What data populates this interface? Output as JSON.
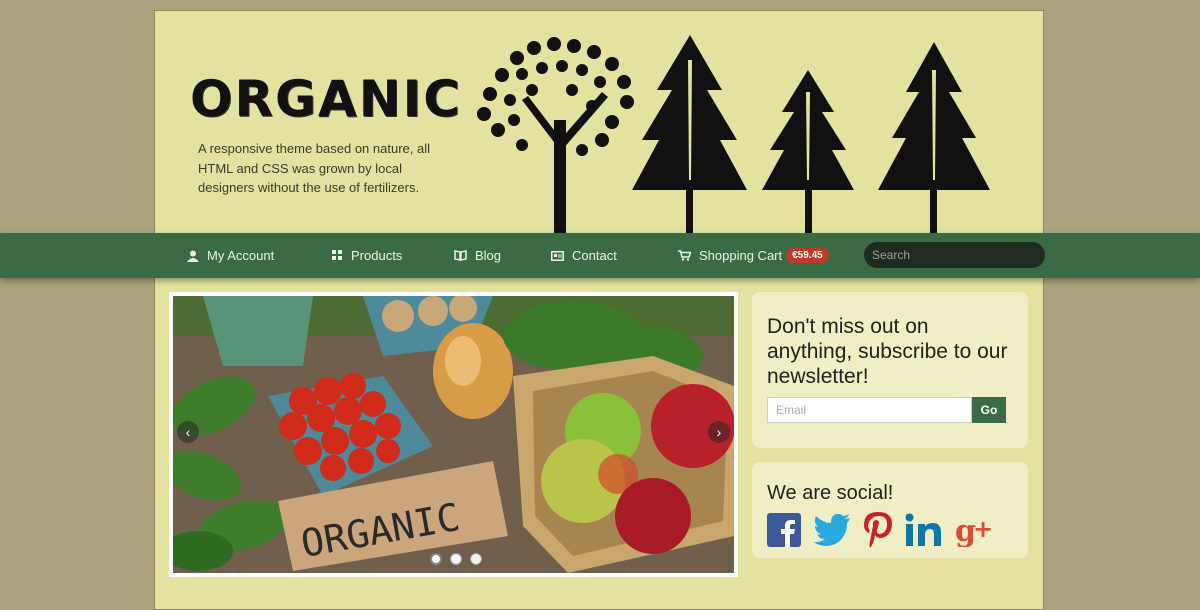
{
  "header": {
    "logo": "ORGANIC",
    "tagline": "A responsive theme based on nature, all HTML and CSS was grown by local designers without the use of fertilizers."
  },
  "nav": {
    "items": [
      {
        "label": "My Account",
        "icon": "user-icon"
      },
      {
        "label": "Products",
        "icon": "grid-icon"
      },
      {
        "label": "Blog",
        "icon": "book-icon"
      },
      {
        "label": "Contact",
        "icon": "card-icon"
      },
      {
        "label": "Shopping Cart",
        "icon": "cart-icon"
      }
    ],
    "cart_total": "€59.45",
    "search_placeholder": "Search"
  },
  "slider": {
    "sign_text": "ORGANIC",
    "slide_count": 3,
    "active_slide": 1
  },
  "newsletter": {
    "heading": "Don't miss out on anything, subscribe to our newsletter!",
    "email_placeholder": "Email",
    "button": "Go"
  },
  "social": {
    "heading": "We are social!",
    "networks": [
      "facebook",
      "twitter",
      "pinterest",
      "linkedin",
      "google-plus"
    ]
  },
  "colors": {
    "page_bg": "#a9a47e",
    "content_bg": "#e3e2a0",
    "nav_bg": "#3b6b45",
    "badge": "#c0392b",
    "facebook": "#3b5998",
    "twitter": "#2aa9e0",
    "pinterest": "#cb2027",
    "linkedin": "#0e76a8",
    "google_plus": "#dc4a38"
  }
}
